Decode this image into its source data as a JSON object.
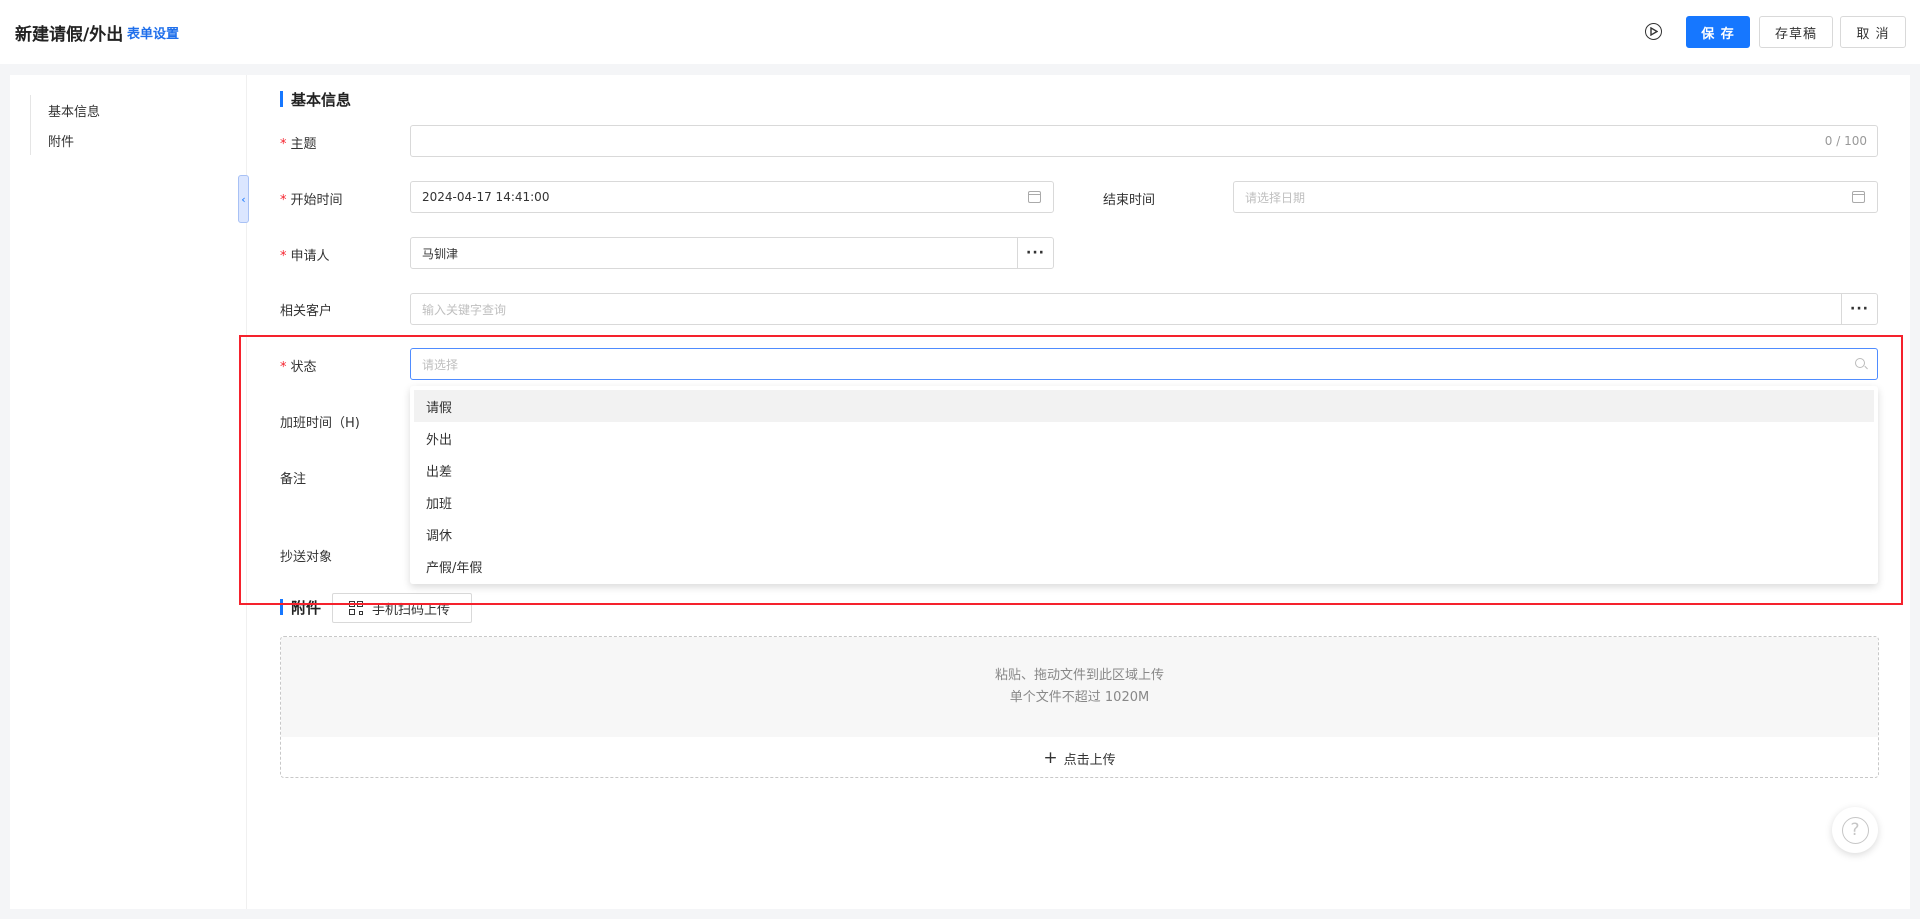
{
  "header": {
    "title": "新建请假/外出",
    "form_settings": "表单设置",
    "save": "保 存",
    "save_draft": "存草稿",
    "cancel": "取 消"
  },
  "sidebar": {
    "items": [
      {
        "label": "基本信息"
      },
      {
        "label": "附件"
      }
    ]
  },
  "basic_info": {
    "section_title": "基本信息",
    "subject": {
      "label": "主题",
      "value": "",
      "counter": "0 / 100"
    },
    "start_time": {
      "label": "开始时间",
      "value": "2024-04-17 14:41:00"
    },
    "end_time": {
      "label": "结束时间",
      "placeholder": "请选择日期"
    },
    "applicant": {
      "label": "申请人",
      "value": "马钏津"
    },
    "related_customer": {
      "label": "相关客户",
      "placeholder": "输入关键字查询"
    },
    "status": {
      "label": "状态",
      "placeholder": "请选择",
      "options": [
        "请假",
        "外出",
        "出差",
        "加班",
        "调休",
        "产假/年假"
      ]
    },
    "overtime": {
      "label": "加班时间（H)"
    },
    "remark": {
      "label": "备注"
    },
    "cc": {
      "label": "抄送对象"
    }
  },
  "attachments": {
    "section_title": "附件",
    "qr_upload": "手机扫码上传",
    "drop_text": "粘贴、拖动文件到此区域上传",
    "limit_text": "单个文件不超过 1020M",
    "upload_button": "点击上传"
  },
  "colors": {
    "primary": "#1677ff",
    "required": "#f5222d",
    "highlight": "#f5222d"
  },
  "icons": [
    "play-circle-icon",
    "calendar-icon",
    "search-icon",
    "ellipsis-icon",
    "qr-code-icon",
    "plus-icon",
    "help-icon",
    "chevron-left-icon"
  ]
}
